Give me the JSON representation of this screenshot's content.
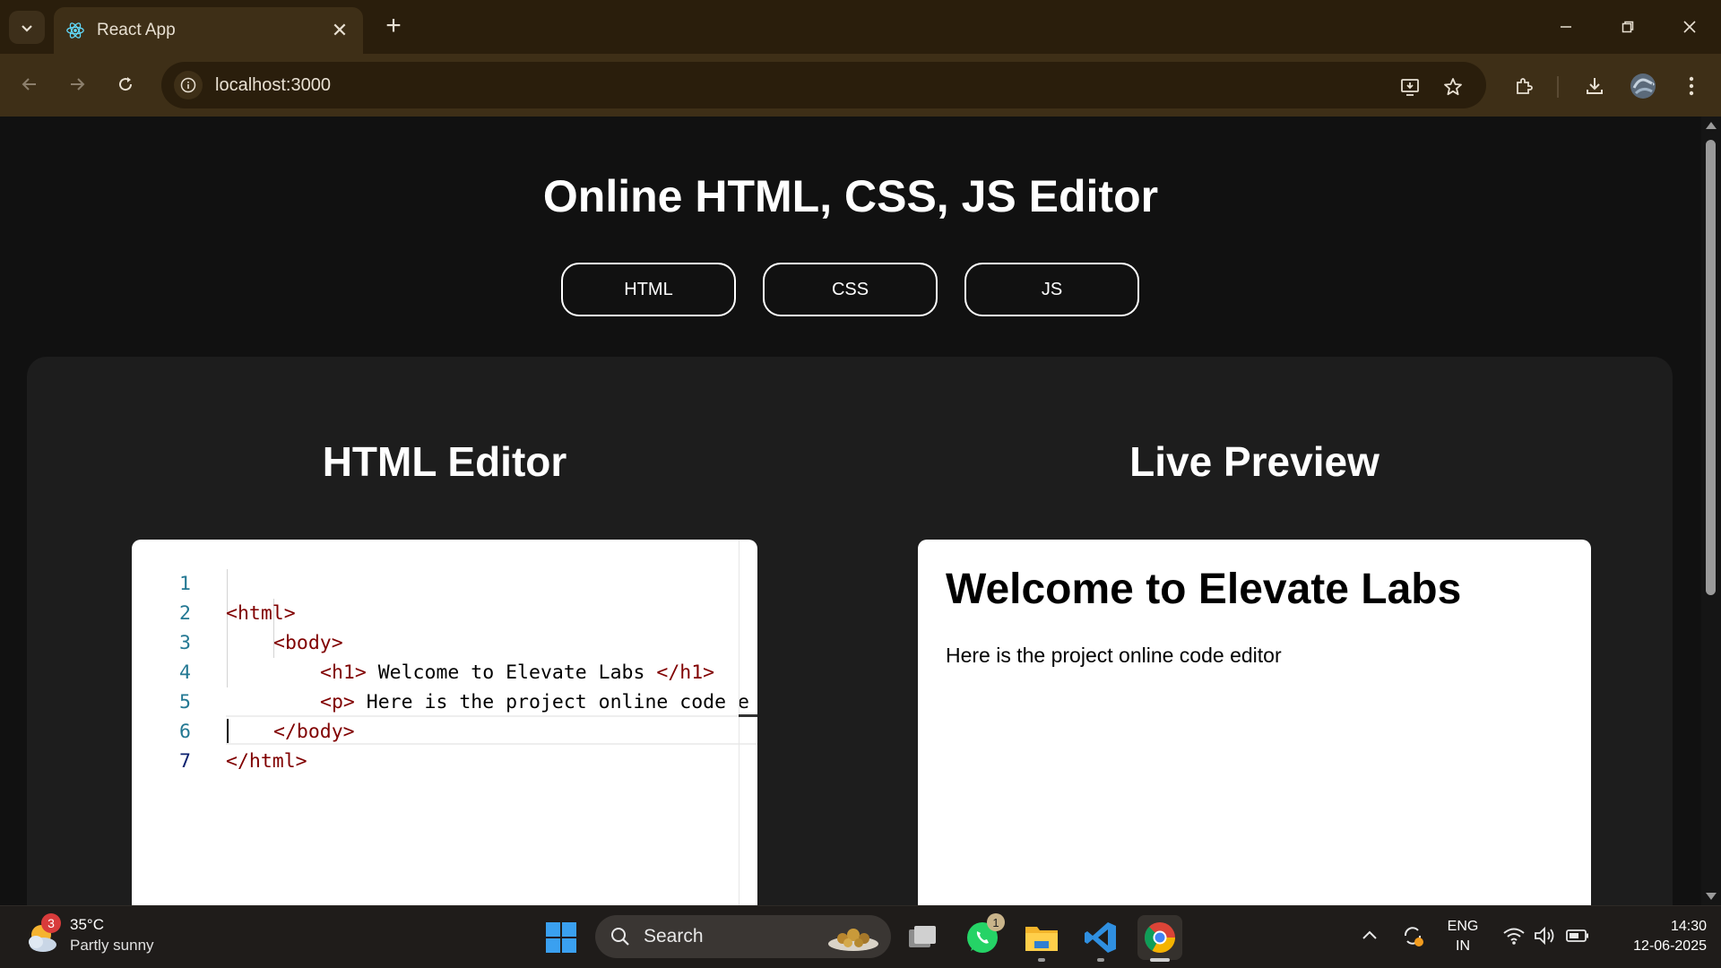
{
  "browser": {
    "tab_title": "React App",
    "url": "localhost:3000"
  },
  "page": {
    "title": "Online HTML, CSS, JS Editor",
    "mode_buttons": [
      "HTML",
      "CSS",
      "JS"
    ],
    "editor_heading": "HTML Editor",
    "preview_heading": "Live Preview"
  },
  "editor": {
    "line_numbers": [
      "1",
      "2",
      "3",
      "4",
      "5",
      "6",
      "7"
    ],
    "lines": [
      [
        "<html>",
        ""
      ],
      [
        "<body>",
        ""
      ],
      [
        "<h1>",
        " Welcome to Elevate Labs ",
        "</h1>"
      ],
      [
        "<p>",
        " Here is the project online code e"
      ],
      [
        "</body>",
        ""
      ],
      [
        "</html>",
        ""
      ],
      [
        "",
        ""
      ]
    ]
  },
  "preview": {
    "heading": "Welcome to Elevate Labs",
    "paragraph": "Here is the project online code editor"
  },
  "taskbar": {
    "weather_badge": "3",
    "temperature": "35°C",
    "weather_desc": "Partly sunny",
    "search_label": "Search",
    "whatsapp_badge": "1",
    "lang_line1": "ENG",
    "lang_line2": "IN",
    "time": "14:30",
    "date": "12-06-2025"
  },
  "colors": {
    "page_bg": "#111111",
    "panel_bg": "#1d1d1d",
    "tag_color": "#800000",
    "line_number_color": "#237893",
    "browser_frame": "#3e2f17"
  }
}
